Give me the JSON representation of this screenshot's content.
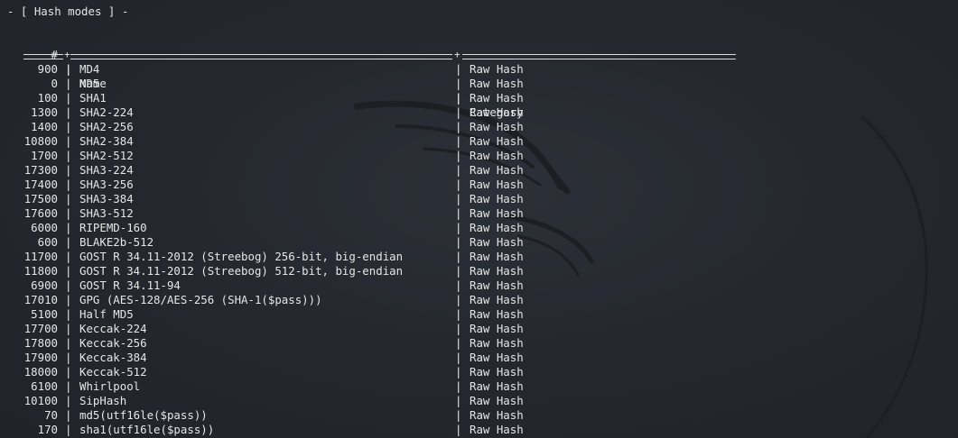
{
  "terminal": {
    "title": "- [ Hash modes ] -",
    "headers": {
      "num": "#",
      "name": "Name",
      "category": "Category"
    },
    "separator": "|",
    "junction": "+",
    "rows": [
      {
        "num": "900",
        "name": "MD4",
        "category": "Raw Hash"
      },
      {
        "num": "0",
        "name": "MD5",
        "category": "Raw Hash"
      },
      {
        "num": "100",
        "name": "SHA1",
        "category": "Raw Hash"
      },
      {
        "num": "1300",
        "name": "SHA2-224",
        "category": "Raw Hash"
      },
      {
        "num": "1400",
        "name": "SHA2-256",
        "category": "Raw Hash"
      },
      {
        "num": "10800",
        "name": "SHA2-384",
        "category": "Raw Hash"
      },
      {
        "num": "1700",
        "name": "SHA2-512",
        "category": "Raw Hash"
      },
      {
        "num": "17300",
        "name": "SHA3-224",
        "category": "Raw Hash"
      },
      {
        "num": "17400",
        "name": "SHA3-256",
        "category": "Raw Hash"
      },
      {
        "num": "17500",
        "name": "SHA3-384",
        "category": "Raw Hash"
      },
      {
        "num": "17600",
        "name": "SHA3-512",
        "category": "Raw Hash"
      },
      {
        "num": "6000",
        "name": "RIPEMD-160",
        "category": "Raw Hash"
      },
      {
        "num": "600",
        "name": "BLAKE2b-512",
        "category": "Raw Hash"
      },
      {
        "num": "11700",
        "name": "GOST R 34.11-2012 (Streebog) 256-bit, big-endian",
        "category": "Raw Hash"
      },
      {
        "num": "11800",
        "name": "GOST R 34.11-2012 (Streebog) 512-bit, big-endian",
        "category": "Raw Hash"
      },
      {
        "num": "6900",
        "name": "GOST R 34.11-94",
        "category": "Raw Hash"
      },
      {
        "num": "17010",
        "name": "GPG (AES-128/AES-256 (SHA-1($pass)))",
        "category": "Raw Hash"
      },
      {
        "num": "5100",
        "name": "Half MD5",
        "category": "Raw Hash"
      },
      {
        "num": "17700",
        "name": "Keccak-224",
        "category": "Raw Hash"
      },
      {
        "num": "17800",
        "name": "Keccak-256",
        "category": "Raw Hash"
      },
      {
        "num": "17900",
        "name": "Keccak-384",
        "category": "Raw Hash"
      },
      {
        "num": "18000",
        "name": "Keccak-512",
        "category": "Raw Hash"
      },
      {
        "num": "6100",
        "name": "Whirlpool",
        "category": "Raw Hash"
      },
      {
        "num": "10100",
        "name": "SipHash",
        "category": "Raw Hash"
      },
      {
        "num": "70",
        "name": "md5(utf16le($pass))",
        "category": "Raw Hash"
      },
      {
        "num": "170",
        "name": "sha1(utf16le($pass))",
        "category": "Raw Hash"
      }
    ]
  },
  "colors": {
    "background": "#24272e",
    "text": "#e6e6e6",
    "watermark": "#1d2025"
  },
  "icons": {
    "watermark": "kali-dragon-icon"
  }
}
